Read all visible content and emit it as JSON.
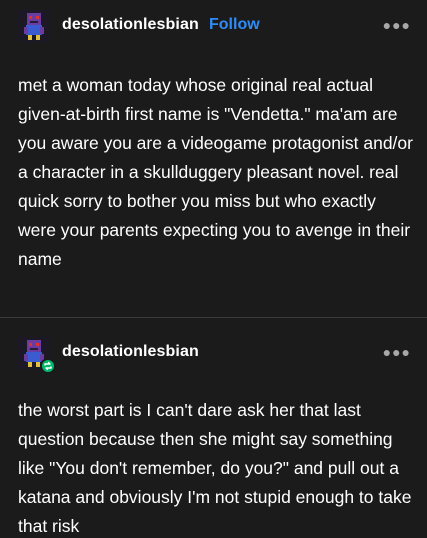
{
  "original_post": {
    "username": "desolationlesbian",
    "follow_label": "Follow",
    "more_icon": "more-horizontal-icon",
    "text": "met a woman today whose original real actual given-at-birth first name is \"Vendetta.\" ma'am are you aware you are a videogame protagonist and/or a character in a skullduggery pleasant novel. real quick sorry to bother you miss but who exactly were your parents expecting you to avenge in their name"
  },
  "reblog": {
    "username": "desolationlesbian",
    "badge_icon": "reblog-icon",
    "more_icon": "more-horizontal-icon",
    "text": "the worst part is I can't dare ask her that last question because then she might say something like \"You don't remember, do you?\" and pull out a katana and obviously I'm not stupid enough to take that risk"
  },
  "colors": {
    "background": "#1b1b1b",
    "text": "#ffffff",
    "follow": "#2f8cf7",
    "reblog_badge": "#00b86b",
    "divider": "#3a3a3a"
  }
}
